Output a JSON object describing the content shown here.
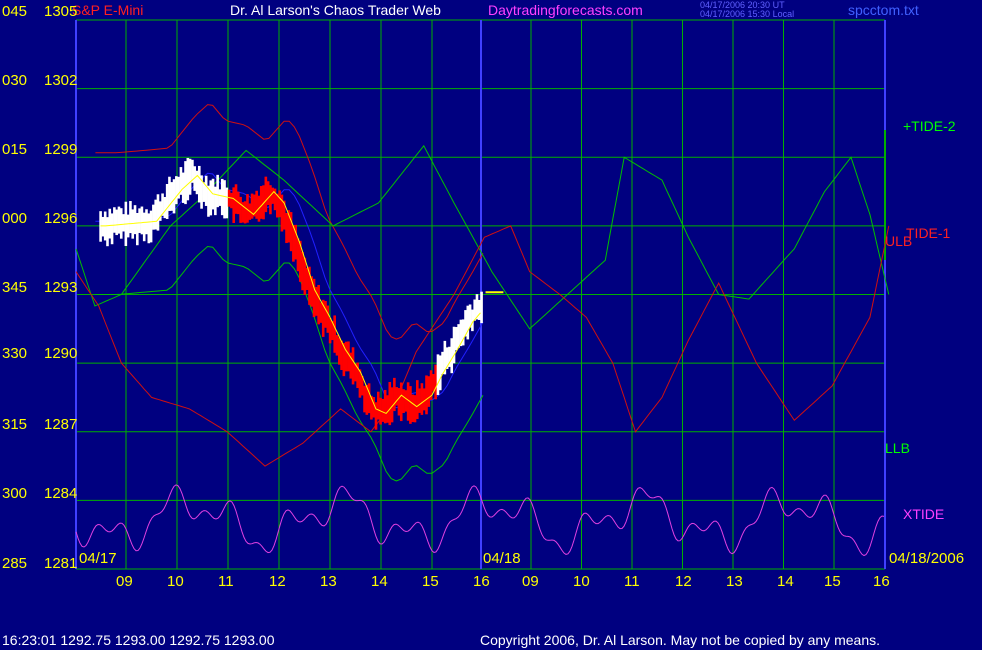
{
  "header": {
    "instrument": "S&P E-Mini",
    "title": "Dr. Al Larson's Chaos Trader Web",
    "site": "Daytradingforecasts.com",
    "timestamp_ut": "04/17/2006 20:30 UT",
    "timestamp_local": "04/17/2006 15:30 Local",
    "file": "spcctom.txt"
  },
  "footer": {
    "quote": "16:23:01  1292.75 1293.00 1292.75 1293.00",
    "copyright": "Copyright 2006, Dr. Al Larson. May not be copied by any means."
  },
  "colors": {
    "background": "#000080",
    "grid": "#00b000",
    "axis": "#4040ff",
    "price_up": "#ffffff",
    "price_down": "#ff0000",
    "average": "#ffff00",
    "blue_curve": "#2020ff",
    "tide2": "#00c000",
    "tide1": "#d01010",
    "xtide": "#e040e0",
    "label_yellow": "#ffff00",
    "label_green": "#00ff00"
  },
  "chart_data": {
    "type": "line",
    "title": "Dr. Al Larson's Chaos Trader Web",
    "y_axis_labels": [
      {
        "time": "045",
        "price": "1305"
      },
      {
        "time": "030",
        "price": "1302"
      },
      {
        "time": "015",
        "price": "1299"
      },
      {
        "time": "000",
        "price": "1296"
      },
      {
        "time": "345",
        "price": "1293"
      },
      {
        "time": "330",
        "price": "1290"
      },
      {
        "time": "315",
        "price": "1287"
      },
      {
        "time": "300",
        "price": "1284"
      },
      {
        "time": "285",
        "price": "1281"
      }
    ],
    "ylim": [
      1281,
      1305
    ],
    "x_date_labels": {
      "start": "04/17",
      "middle": "04/18",
      "end": "04/18/2006"
    },
    "x_hour_labels": [
      "09",
      "10",
      "11",
      "12",
      "13",
      "14",
      "15",
      "16",
      "09",
      "10",
      "11",
      "12",
      "13",
      "14",
      "15",
      "16"
    ],
    "series_labels": {
      "tide2": "+TIDE-2",
      "tide1": "TIDE-1",
      "ulb": "ULB",
      "llb": "LLB",
      "xtide": "XTIDE"
    },
    "price_series": {
      "name": "S&P E-Mini",
      "x_hours": [
        8.5,
        9.0,
        9.5,
        10.0,
        10.3,
        10.6,
        11.0,
        11.4,
        11.8,
        12.0,
        12.3,
        12.6,
        12.9,
        13.2,
        13.5,
        13.8,
        14.0,
        14.3,
        14.6,
        14.9,
        15.1,
        15.4,
        15.7,
        16.0
      ],
      "close": [
        1296.0,
        1296.1,
        1296.2,
        1297.6,
        1298.2,
        1297.4,
        1297.2,
        1296.5,
        1297.5,
        1297.0,
        1295.3,
        1293.2,
        1292.0,
        1290.6,
        1289.6,
        1288.0,
        1287.8,
        1288.6,
        1288.1,
        1288.6,
        1289.5,
        1290.6,
        1291.8,
        1292.6
      ],
      "down_segment_hours": [
        11.0,
        15.1
      ]
    },
    "forecast_line": {
      "x_hours": [
        16.05,
        16.4
      ],
      "value": 1293.1
    },
    "tide2": {
      "x_days": [
        0.0,
        0.05,
        0.12,
        0.25,
        0.33,
        0.45,
        0.55,
        0.68,
        0.8,
        0.92,
        1.0,
        1.1,
        1.2,
        1.3,
        1.4,
        1.45,
        1.55,
        1.62,
        1.7,
        1.78,
        1.9,
        1.98,
        2.05,
        2.1,
        2.15
      ],
      "value": [
        1295.0,
        1292.5,
        1293.0,
        1296.0,
        1297.2,
        1299.3,
        1298.0,
        1296.0,
        1297.0,
        1299.5,
        1297.0,
        1294.0,
        1291.5,
        1293.0,
        1294.5,
        1299.0,
        1298.0,
        1295.5,
        1293.0,
        1292.8,
        1295.0,
        1297.5,
        1299.0,
        1296.5,
        1293.0
      ]
    },
    "tide1": {
      "x_days": [
        0.0,
        0.06,
        0.12,
        0.2,
        0.3,
        0.4,
        0.5,
        0.6,
        0.7,
        0.78,
        0.85,
        0.9,
        1.0,
        1.08,
        1.15,
        1.2,
        1.28,
        1.35,
        1.42,
        1.48,
        1.55,
        1.62,
        1.7,
        1.8,
        1.9,
        2.0,
        2.1,
        2.15
      ],
      "value": [
        1294.0,
        1292.5,
        1290.0,
        1288.5,
        1288.0,
        1287.0,
        1285.5,
        1286.5,
        1288.0,
        1287.0,
        1288.5,
        1290.5,
        1293.0,
        1295.5,
        1296.0,
        1294.0,
        1293.0,
        1292.0,
        1290.0,
        1287.0,
        1288.5,
        1291.0,
        1293.5,
        1290.0,
        1287.5,
        1289.0,
        1292.0,
        1296.0
      ]
    },
    "bands": {
      "ULB_label_value": 1295.5,
      "LLB_label_value": 1285.7
    }
  }
}
